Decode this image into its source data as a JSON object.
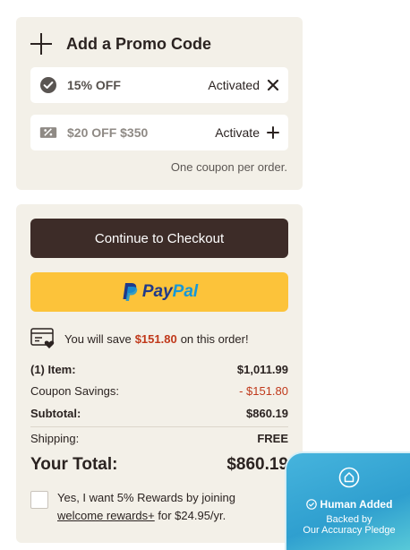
{
  "promo": {
    "title": "Add a Promo Code",
    "coupons": [
      {
        "code": "15% OFF",
        "action": "Activated",
        "action_icon": "close-icon",
        "icon": "check-circle-icon"
      },
      {
        "code": "$20 OFF $350",
        "action": "Activate",
        "action_icon": "plus-icon",
        "icon": "discount-tag-icon"
      }
    ],
    "note": "One coupon per order."
  },
  "checkout": {
    "button_label": "Continue to Checkout",
    "paypal": {
      "pay": "Pay",
      "pal": "Pal"
    },
    "savings": {
      "prefix": "You will save",
      "amount": "$151.80",
      "suffix": "on this order!"
    },
    "summary": {
      "items_label": "(1) Item:",
      "items_value": "$1,011.99",
      "coupon_label": "Coupon Savings:",
      "coupon_value": "- $151.80",
      "subtotal_label": "Subtotal:",
      "subtotal_value": "$860.19",
      "shipping_label": "Shipping:",
      "shipping_value": "FREE",
      "total_label": "Your Total:",
      "total_value": "$860.19"
    },
    "rewards": {
      "text": "Yes, I want 5% Rewards by joining",
      "link": "welcome rewards+",
      "price_text": "for $24.95/yr."
    }
  },
  "badge": {
    "title": "Human Added",
    "line1": "Backed by",
    "line2": "Our Accuracy Pledge"
  },
  "colors": {
    "panel_bg": "#f3f0e8",
    "checkout_btn": "#3d2c28",
    "paypal_btn": "#fcc33a",
    "accent_red": "#c0391b",
    "badge_blue": "#2f9fcf"
  }
}
